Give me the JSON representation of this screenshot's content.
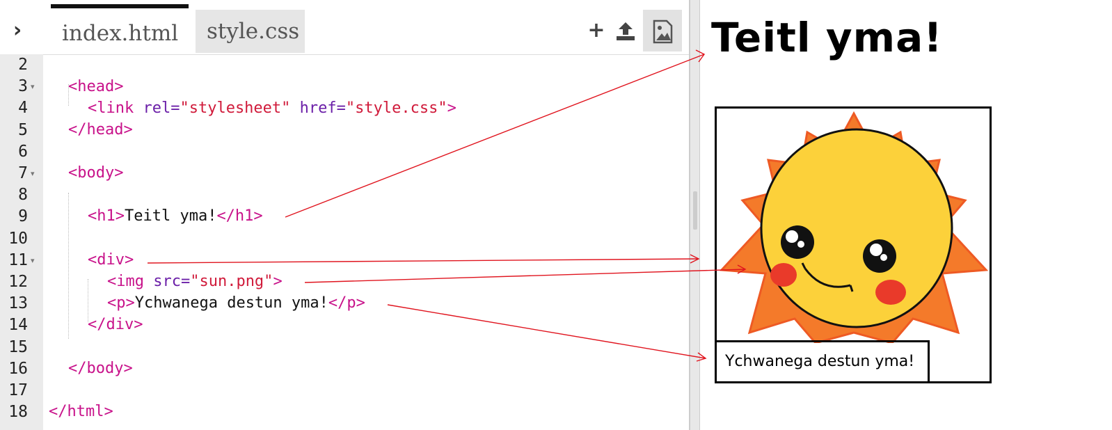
{
  "editor": {
    "tabs": [
      {
        "label": "index.html",
        "active": true
      },
      {
        "label": "style.css",
        "active": false
      }
    ],
    "toggle_icon": "chevron-right-icon",
    "toolbar_icons": [
      "plus-icon",
      "upload-icon",
      "image-icon"
    ],
    "line_numbers": [
      "2",
      "3",
      "4",
      "5",
      "6",
      "7",
      "8",
      "9",
      "10",
      "11",
      "12",
      "13",
      "14",
      "15",
      "16",
      "17",
      "18"
    ],
    "folds": [
      "3",
      "7",
      "11"
    ]
  },
  "preview": {
    "heading": "Teitl yma!",
    "caption": "Ychwanega destun yma!",
    "image": "sun-image"
  },
  "colors": {
    "tag": "#c8128a",
    "attr": "#6b1fa8",
    "string": "#d01a3a",
    "arrow": "#e0141e"
  }
}
